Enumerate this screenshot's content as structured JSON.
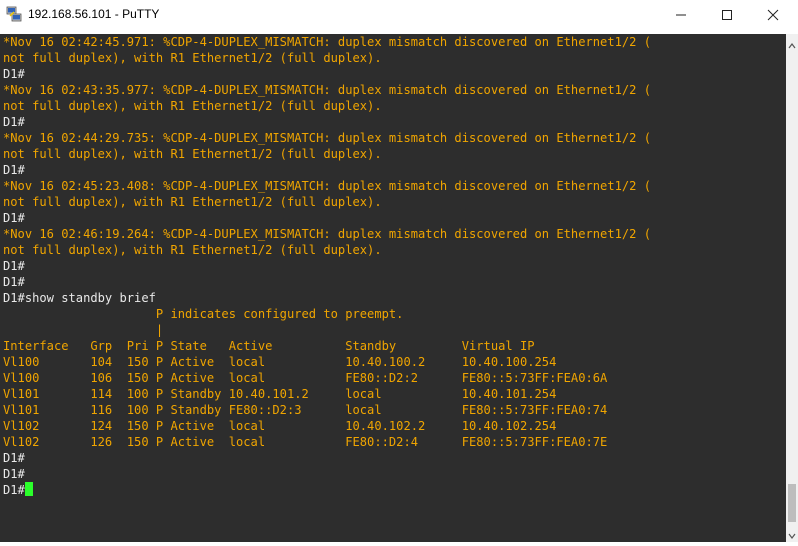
{
  "window": {
    "title": "192.168.56.101 - PuTTY",
    "app_icon": "putty-icon",
    "min_icon": "minimize-icon",
    "max_icon": "maximize-icon",
    "close_icon": "close-icon"
  },
  "terminal": {
    "lines": [
      "*Nov 16 02:42:45.971: %CDP-4-DUPLEX_MISMATCH: duplex mismatch discovered on Ethernet1/2 (",
      "not full duplex), with R1 Ethernet1/2 (full duplex).",
      "D1#",
      "*Nov 16 02:43:35.977: %CDP-4-DUPLEX_MISMATCH: duplex mismatch discovered on Ethernet1/2 (",
      "not full duplex), with R1 Ethernet1/2 (full duplex).",
      "D1#",
      "*Nov 16 02:44:29.735: %CDP-4-DUPLEX_MISMATCH: duplex mismatch discovered on Ethernet1/2 (",
      "not full duplex), with R1 Ethernet1/2 (full duplex).",
      "D1#",
      "*Nov 16 02:45:23.408: %CDP-4-DUPLEX_MISMATCH: duplex mismatch discovered on Ethernet1/2 (",
      "not full duplex), with R1 Ethernet1/2 (full duplex).",
      "D1#",
      "*Nov 16 02:46:19.264: %CDP-4-DUPLEX_MISMATCH: duplex mismatch discovered on Ethernet1/2 (",
      "not full duplex), with R1 Ethernet1/2 (full duplex).",
      "D1#",
      "D1#",
      "D1#show standby brief",
      "                     P indicates configured to preempt.",
      "                     |",
      "Interface   Grp  Pri P State   Active          Standby         Virtual IP",
      "Vl100       104  150 P Active  local           10.40.100.2     10.40.100.254",
      "Vl100       106  150 P Active  local           FE80::D2:2      FE80::5:73FF:FEA0:6A",
      "Vl101       114  100 P Standby 10.40.101.2     local           10.40.101.254",
      "Vl101       116  100 P Standby FE80::D2:3      local           FE80::5:73FF:FEA0:74",
      "Vl102       124  150 P Active  local           10.40.102.2     10.40.102.254",
      "Vl102       126  150 P Active  local           FE80::D2:4      FE80::5:73FF:FEA0:7E",
      "D1#",
      "D1#",
      "D1#"
    ],
    "line_types": [
      "log",
      "log",
      "prompt",
      "log",
      "log",
      "prompt",
      "log",
      "log",
      "prompt",
      "log",
      "log",
      "prompt",
      "log",
      "log",
      "prompt",
      "prompt",
      "prompt",
      "table",
      "table",
      "table",
      "table",
      "table",
      "table",
      "table",
      "table",
      "table",
      "prompt",
      "prompt",
      "prompt"
    ],
    "colors": {
      "background": "#2d2d2d",
      "log_text": "#f0a500",
      "prompt_text": "#e9e9e9",
      "cursor": "#2bff2b"
    }
  },
  "scrollbar": {
    "up_icon": "scroll-up-arrow-icon",
    "down_icon": "scroll-down-arrow-icon"
  }
}
